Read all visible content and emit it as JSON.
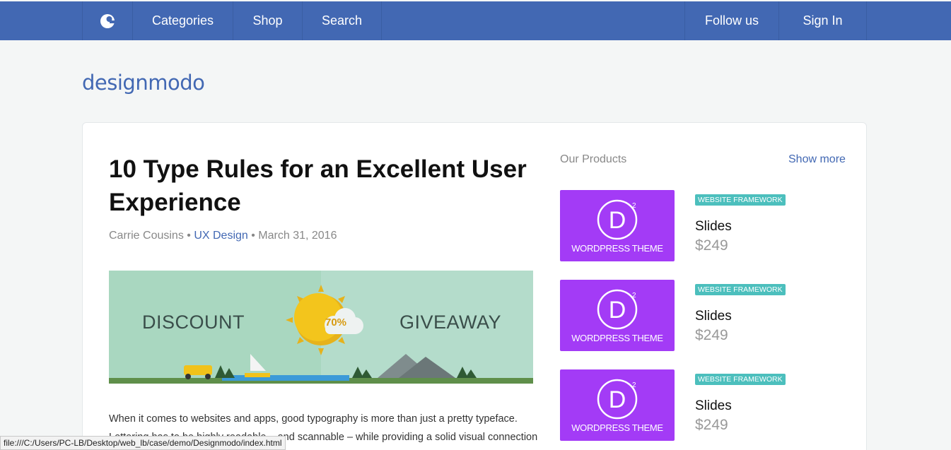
{
  "nav": {
    "items": [
      "Categories",
      "Shop",
      "Search"
    ],
    "right": [
      "Follow us",
      "Sign In"
    ]
  },
  "brand": "designmodo",
  "article": {
    "title": "10 Type Rules for an Excellent User Experience",
    "author": "Carrie Cousins",
    "sep1": " • ",
    "category": "UX Design",
    "sep2": " • ",
    "date": "March 31, 2016",
    "hero": {
      "left": "DISCOUNT",
      "right": "GIVEAWAY",
      "badge": "70%"
    },
    "body": "When it comes to websites and apps, good typography is more than just a pretty typeface. Lettering has to be highly readable – and scannable – while providing a solid visual connection to"
  },
  "sidebar": {
    "heading": "Our Products",
    "show_more": "Show more",
    "products": [
      {
        "badge": "WEBSITE FRAMEWORK",
        "name": "Slides",
        "price": "$249",
        "thumb_label": "WORDPRESS THEME"
      },
      {
        "badge": "WEBSITE FRAMEWORK",
        "name": "Slides",
        "price": "$249",
        "thumb_label": "WORDPRESS THEME"
      },
      {
        "badge": "WEBSITE FRAMEWORK",
        "name": "Slides",
        "price": "$249",
        "thumb_label": "WORDPRESS THEME"
      }
    ]
  },
  "status_url": "file:///C:/Users/PC-LB/Desktop/web_lb/case/demo/Designmodo/index.html",
  "colors": {
    "accent": "#4268b3",
    "product": "#a33bf6",
    "badge": "#4cbfbd"
  }
}
